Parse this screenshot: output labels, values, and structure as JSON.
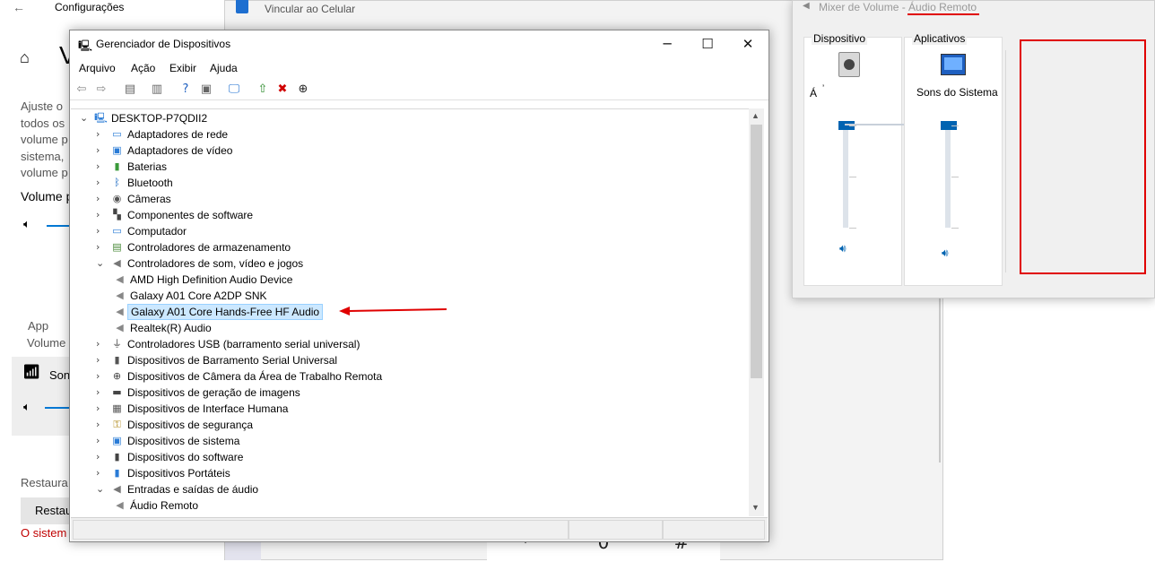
{
  "settings": {
    "title": "Configurações",
    "heading_fragment": "V",
    "desc_lines": [
      "Ajuste o",
      "todos os",
      "volume p",
      "sistema,",
      "volume p"
    ],
    "volume_label": "Volume p",
    "app_lines": [
      "App",
      "Volume"
    ],
    "app_name": "Son",
    "restore_label": "Restaura",
    "restore_button": "Restau",
    "error_text": "O sistem"
  },
  "phone": {
    "title": "Vincular ao Celular",
    "keys": [
      "*",
      "0",
      "#"
    ]
  },
  "device_manager": {
    "title": "Gerenciador de Dispositivos",
    "menu": [
      "Arquivo",
      "Ação",
      "Exibir",
      "Ajuda"
    ],
    "root": "DESKTOP-P7QDII2",
    "items": [
      {
        "label": "Adaptadores de rede",
        "icon": "network-adapter-icon",
        "glyph": "▭",
        "color": "#2a7bd6",
        "level": 1,
        "state": "collapsed"
      },
      {
        "label": "Adaptadores de vídeo",
        "icon": "display-adapter-icon",
        "glyph": "▣",
        "color": "#2a7bd6",
        "level": 1,
        "state": "collapsed"
      },
      {
        "label": "Baterias",
        "icon": "battery-icon",
        "glyph": "▮",
        "color": "#3a9a3a",
        "level": 1,
        "state": "collapsed"
      },
      {
        "label": "Bluetooth",
        "icon": "bluetooth-icon",
        "glyph": "ᛒ",
        "color": "#1565c0",
        "level": 1,
        "state": "collapsed"
      },
      {
        "label": "Câmeras",
        "icon": "camera-icon",
        "glyph": "◉",
        "color": "#555555",
        "level": 1,
        "state": "collapsed"
      },
      {
        "label": "Componentes de software",
        "icon": "software-component-icon",
        "glyph": "▚",
        "color": "#444444",
        "level": 1,
        "state": "collapsed"
      },
      {
        "label": "Computador",
        "icon": "computer-icon",
        "glyph": "▭",
        "color": "#2a7bd6",
        "level": 1,
        "state": "collapsed"
      },
      {
        "label": "Controladores de armazenamento",
        "icon": "storage-controller-icon",
        "glyph": "▤",
        "color": "#4a8a3a",
        "level": 1,
        "state": "collapsed"
      },
      {
        "label": "Controladores de som, vídeo e jogos",
        "icon": "sound-controller-icon",
        "glyph": "◀",
        "color": "#777777",
        "level": 1,
        "state": "expanded"
      },
      {
        "label": "AMD High Definition Audio Device",
        "icon": "audio-device-icon",
        "glyph": "◀",
        "color": "#888888",
        "level": 2,
        "state": "leaf"
      },
      {
        "label": "Galaxy A01 Core A2DP SNK",
        "icon": "audio-device-icon",
        "glyph": "◀",
        "color": "#888888",
        "level": 2,
        "state": "leaf"
      },
      {
        "label": "Galaxy A01 Core Hands-Free HF Audio",
        "icon": "audio-device-icon",
        "glyph": "◀",
        "color": "#888888",
        "level": 2,
        "state": "leaf",
        "selected": true
      },
      {
        "label": "Realtek(R) Audio",
        "icon": "audio-device-icon",
        "glyph": "◀",
        "color": "#888888",
        "level": 2,
        "state": "leaf"
      },
      {
        "label": "Controladores USB (barramento serial universal)",
        "icon": "usb-icon",
        "glyph": "⏚",
        "color": "#444444",
        "level": 1,
        "state": "collapsed"
      },
      {
        "label": "Dispositivos de Barramento Serial Universal",
        "icon": "usb-device-icon",
        "glyph": "▮",
        "color": "#555555",
        "level": 1,
        "state": "collapsed"
      },
      {
        "label": "Dispositivos de Câmera da Área de Trabalho Remota",
        "icon": "remote-camera-icon",
        "glyph": "⊕",
        "color": "#444444",
        "level": 1,
        "state": "collapsed"
      },
      {
        "label": "Dispositivos de geração de imagens",
        "icon": "imaging-device-icon",
        "glyph": "▬",
        "color": "#444444",
        "level": 1,
        "state": "collapsed"
      },
      {
        "label": "Dispositivos de Interface Humana",
        "icon": "hid-icon",
        "glyph": "▦",
        "color": "#555555",
        "level": 1,
        "state": "collapsed"
      },
      {
        "label": "Dispositivos de segurança",
        "icon": "security-device-icon",
        "glyph": "⚿",
        "color": "#b08a1a",
        "level": 1,
        "state": "collapsed"
      },
      {
        "label": "Dispositivos de sistema",
        "icon": "system-device-icon",
        "glyph": "▣",
        "color": "#2a7bd6",
        "level": 1,
        "state": "collapsed"
      },
      {
        "label": "Dispositivos do software",
        "icon": "software-device-icon",
        "glyph": "▮",
        "color": "#444444",
        "level": 1,
        "state": "collapsed"
      },
      {
        "label": "Dispositivos Portáteis",
        "icon": "portable-device-icon",
        "glyph": "▮",
        "color": "#2a7bd6",
        "level": 1,
        "state": "collapsed"
      },
      {
        "label": "Entradas e saídas de áudio",
        "icon": "audio-io-icon",
        "glyph": "◀",
        "color": "#777777",
        "level": 1,
        "state": "expanded"
      },
      {
        "label": "Áudio Remoto",
        "icon": "audio-endpoint-icon",
        "glyph": "◀",
        "color": "#888888",
        "level": 2,
        "state": "leaf"
      }
    ]
  },
  "mixer": {
    "title": "Mixer de Volume - ",
    "title_highlight": "Áudio Remoto",
    "device_panel": {
      "title": "Dispositivo",
      "label": "Á"
    },
    "apps_panel": {
      "title": "Aplicativos",
      "label": "Sons do Sistema"
    },
    "device_volume": 1.0,
    "app_volume": 1.0
  },
  "colors": {
    "accent": "#0078d4",
    "highlight": "#e00000",
    "selection": "#cce8ff"
  }
}
